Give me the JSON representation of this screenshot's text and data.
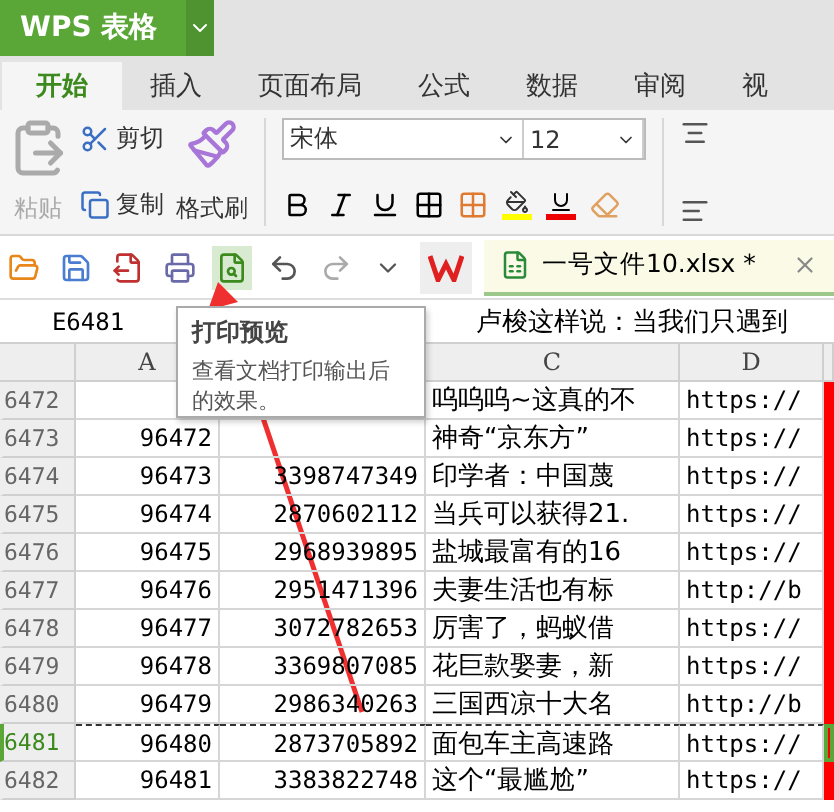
{
  "title_bar": {
    "app": "WPS 表格"
  },
  "tabs": [
    {
      "label": "开始",
      "selected": true
    },
    {
      "label": "插入",
      "selected": false
    },
    {
      "label": "页面布局",
      "selected": false
    },
    {
      "label": "公式",
      "selected": false
    },
    {
      "label": "数据",
      "selected": false
    },
    {
      "label": "审阅",
      "selected": false
    },
    {
      "label": "视",
      "selected": false
    }
  ],
  "ribbon": {
    "paste": {
      "label": "粘贴",
      "disabled": true
    },
    "cut": "剪切",
    "copy": "复制",
    "format_painter": "格式刷",
    "font_name": "宋体",
    "font_size": "12"
  },
  "document_tab": {
    "title": "一号文件10.xlsx *"
  },
  "tooltip": {
    "title": "打印预览",
    "text": "查看文档打印输出后的效果。"
  },
  "formula_bar": {
    "cell": "E6481",
    "content": "卢梭这样说：当我们只遇到"
  },
  "columns": [
    "A",
    "C",
    "D"
  ],
  "rows": [
    {
      "number": "6472",
      "c": "呜呜呜~这真的不",
      "d": "https://",
      "selected": false
    },
    {
      "number": "6473",
      "a": "96472",
      "c": "神奇“京东方”",
      "d": "https://",
      "selected": false
    },
    {
      "number": "6474",
      "a": "96473",
      "b": "3398747349",
      "c": "印学者：中国蔑",
      "d": "https://",
      "selected": false
    },
    {
      "number": "6475",
      "a": "96474",
      "b": "2870602112",
      "c": "当兵可以获得21.",
      "d": "https://",
      "selected": false
    },
    {
      "number": "6476",
      "a": "96475",
      "b": "2968939895",
      "c": "盐城最富有的16",
      "d": "https://",
      "selected": false
    },
    {
      "number": "6477",
      "a": "96476",
      "b": "2951471396",
      "c": "夫妻生活也有标",
      "d": "http://b",
      "selected": false
    },
    {
      "number": "6478",
      "a": "96477",
      "b": "3072782653",
      "c": "厉害了，蚂蚁借",
      "d": "https://",
      "selected": false
    },
    {
      "number": "6479",
      "a": "96478",
      "b": "3369807085",
      "c": "花巨款娶妻，新",
      "d": "https://",
      "selected": false
    },
    {
      "number": "6480",
      "a": "96479",
      "b": "2986340263",
      "c": "三国西凉十大名",
      "d": "http://b",
      "selected": false
    },
    {
      "number": "6481",
      "a": "96480",
      "b": "2873705892",
      "c": "面包车主高速路",
      "d": "https://",
      "selected": true
    },
    {
      "number": "6482",
      "a": "96481",
      "b": "3383822748",
      "c": "这个“最尴尬”",
      "d": "https://",
      "selected": false
    }
  ]
}
